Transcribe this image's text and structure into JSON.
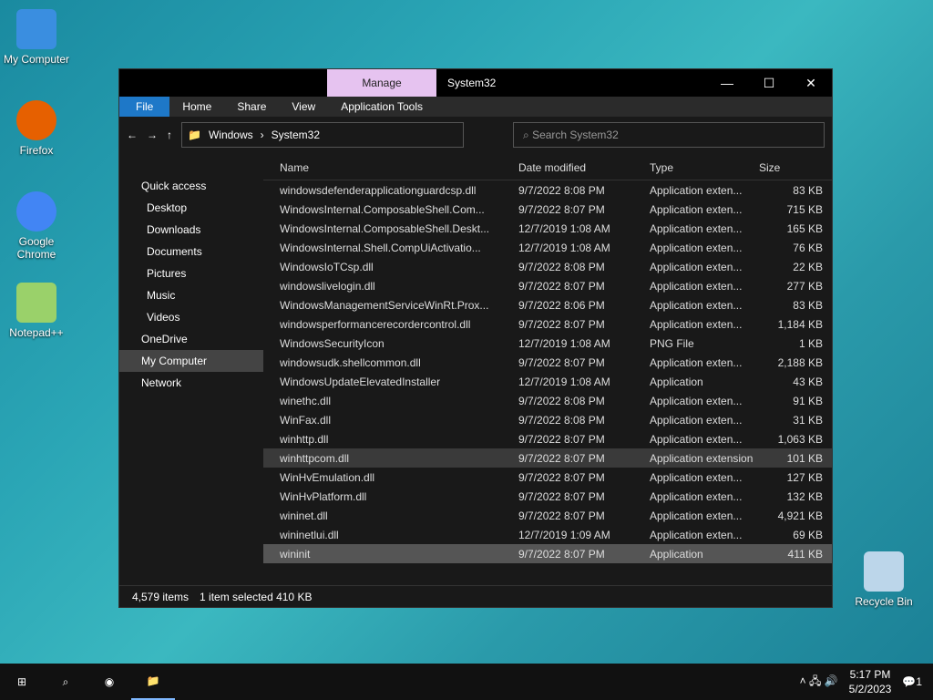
{
  "desktop": {
    "my_computer": "My Computer",
    "firefox": "Firefox",
    "chrome": "Google Chrome",
    "notepadpp": "Notepad++",
    "recycle": "Recycle Bin"
  },
  "window": {
    "manage": "Manage",
    "title": "System32",
    "ribbon": [
      "File",
      "Home",
      "Share",
      "View",
      "Application Tools"
    ],
    "path": [
      "Windows",
      "System32"
    ],
    "search_placeholder": "Search System32"
  },
  "sidebar": [
    "Quick access",
    "Desktop",
    "Downloads",
    "Documents",
    "Pictures",
    "Music",
    "Videos",
    "OneDrive",
    "My Computer",
    "Network"
  ],
  "columns": {
    "name": "Name",
    "date": "Date modified",
    "type": "Type",
    "size": "Size"
  },
  "files": [
    {
      "name": "windowsdefenderapplicationguardcsp.dll",
      "date": "9/7/2022 8:08 PM",
      "type": "Application exten...",
      "size": "83 KB"
    },
    {
      "name": "WindowsInternal.ComposableShell.Com...",
      "date": "9/7/2022 8:07 PM",
      "type": "Application exten...",
      "size": "715 KB"
    },
    {
      "name": "WindowsInternal.ComposableShell.Deskt...",
      "date": "12/7/2019 1:08 AM",
      "type": "Application exten...",
      "size": "165 KB"
    },
    {
      "name": "WindowsInternal.Shell.CompUiActivatio...",
      "date": "12/7/2019 1:08 AM",
      "type": "Application exten...",
      "size": "76 KB"
    },
    {
      "name": "WindowsIoTCsp.dll",
      "date": "9/7/2022 8:08 PM",
      "type": "Application exten...",
      "size": "22 KB"
    },
    {
      "name": "windowslivelogin.dll",
      "date": "9/7/2022 8:07 PM",
      "type": "Application exten...",
      "size": "277 KB"
    },
    {
      "name": "WindowsManagementServiceWinRt.Prox...",
      "date": "9/7/2022 8:06 PM",
      "type": "Application exten...",
      "size": "83 KB"
    },
    {
      "name": "windowsperformancerecordercontrol.dll",
      "date": "9/7/2022 8:07 PM",
      "type": "Application exten...",
      "size": "1,184 KB"
    },
    {
      "name": "WindowsSecurityIcon",
      "date": "12/7/2019 1:08 AM",
      "type": "PNG File",
      "size": "1 KB"
    },
    {
      "name": "windowsudk.shellcommon.dll",
      "date": "9/7/2022 8:07 PM",
      "type": "Application exten...",
      "size": "2,188 KB"
    },
    {
      "name": "WindowsUpdateElevatedInstaller",
      "date": "12/7/2019 1:08 AM",
      "type": "Application",
      "size": "43 KB"
    },
    {
      "name": "winethc.dll",
      "date": "9/7/2022 8:08 PM",
      "type": "Application exten...",
      "size": "91 KB"
    },
    {
      "name": "WinFax.dll",
      "date": "9/7/2022 8:08 PM",
      "type": "Application exten...",
      "size": "31 KB"
    },
    {
      "name": "winhttp.dll",
      "date": "9/7/2022 8:07 PM",
      "type": "Application exten...",
      "size": "1,063 KB"
    },
    {
      "name": "winhttpcom.dll",
      "date": "9/7/2022 8:07 PM",
      "type": "Application extension",
      "size": "101 KB"
    },
    {
      "name": "WinHvEmulation.dll",
      "date": "9/7/2022 8:07 PM",
      "type": "Application exten...",
      "size": "127 KB"
    },
    {
      "name": "WinHvPlatform.dll",
      "date": "9/7/2022 8:07 PM",
      "type": "Application exten...",
      "size": "132 KB"
    },
    {
      "name": "wininet.dll",
      "date": "9/7/2022 8:07 PM",
      "type": "Application exten...",
      "size": "4,921 KB"
    },
    {
      "name": "wininetlui.dll",
      "date": "12/7/2019 1:09 AM",
      "type": "Application exten...",
      "size": "69 KB"
    },
    {
      "name": "wininit",
      "date": "9/7/2022 8:07 PM",
      "type": "Application",
      "size": "411 KB"
    }
  ],
  "status": {
    "items": "4,579 items",
    "selected": "1 item selected  410 KB"
  },
  "taskbar": {
    "time": "5:17 PM",
    "date": "5/2/2023",
    "notif_count": "1"
  },
  "icons": [
    "folder-icon",
    "search-icon",
    "windows-icon",
    "chrome-icon",
    "file-explorer-icon"
  ]
}
